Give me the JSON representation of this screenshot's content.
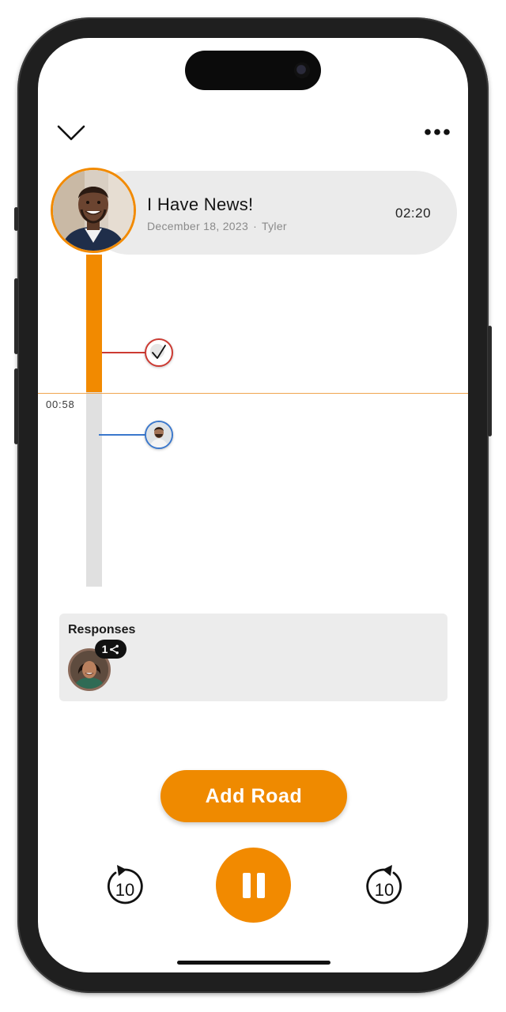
{
  "recording": {
    "title": "I Have News!",
    "date": "December 18, 2023",
    "separator": "·",
    "author": "Tyler",
    "duration": "02:20"
  },
  "timeline": {
    "current_time": "00:58",
    "progress_fraction": 0.414,
    "branches": [
      {
        "type": "checkmark-reply",
        "color": "#cc3a32"
      },
      {
        "type": "user-reply",
        "color": "#3b78cc"
      }
    ]
  },
  "responses": {
    "label": "Responses",
    "items": [
      {
        "badge_count": "1",
        "badge_icon": "branch-icon"
      }
    ]
  },
  "controls": {
    "add_road_label": "Add Road",
    "skip_back_label": "10",
    "skip_forward_label": "10",
    "play_state": "playing"
  },
  "colors": {
    "accent": "#f28a00",
    "track": "#e0e0e0",
    "card": "#ebebeb"
  }
}
